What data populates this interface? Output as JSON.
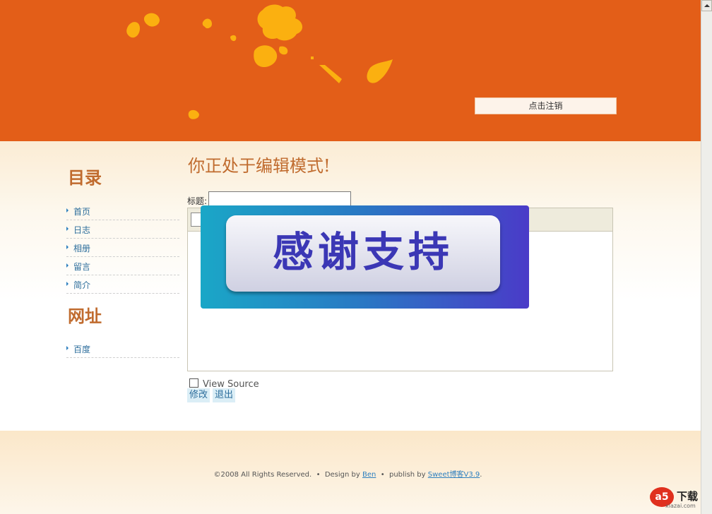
{
  "header": {
    "logout_label": "点击注销"
  },
  "sidebar": {
    "catalog_title": "目录",
    "catalog_items": [
      {
        "label": "首页"
      },
      {
        "label": "日志"
      },
      {
        "label": "相册"
      },
      {
        "label": "留言"
      },
      {
        "label": "简介"
      }
    ],
    "links_title": "网址",
    "link_items": [
      {
        "label": "百度"
      }
    ]
  },
  "main": {
    "heading": "你正处于编辑模式!",
    "title_label": "标题:",
    "title_value": "",
    "view_source_label": "View Source",
    "view_source_checked": false,
    "modify_label": "修改",
    "exit_label": "退出"
  },
  "overlay": {
    "text": "感谢支持"
  },
  "footer": {
    "copyright": "©2008 All Rights Reserved.",
    "sep1": "•",
    "design_prefix": "Design by",
    "design_author": "Ben",
    "sep2": "•",
    "publish_prefix": "publish by",
    "publish_name": "Sweet博客V3.9",
    "end": "."
  },
  "watermark": {
    "logo": "a5",
    "text": "下载",
    "url": "xiazai.com"
  },
  "colors": {
    "header_bg": "#e35e18",
    "splash": "#fbb010",
    "accent_title": "#c06b2e",
    "link": "#2d6e9c"
  }
}
